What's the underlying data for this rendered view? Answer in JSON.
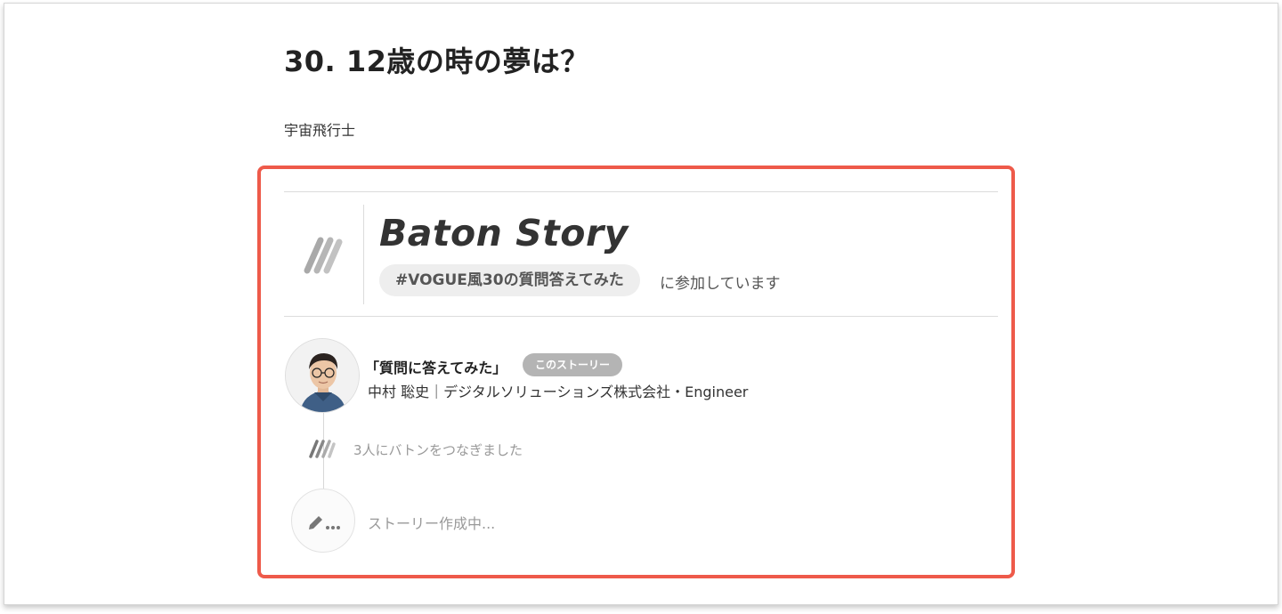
{
  "question": {
    "title": "30. 12歳の時の夢は？",
    "answer": "宇宙飛行士"
  },
  "baton": {
    "brand": "Baton Story",
    "hashtag": "#VOGUE風30の質問答えてみた",
    "joined_text": "に参加しています",
    "logo_icon": "baton-sticks-icon"
  },
  "story": {
    "title": "「質問に答えてみた」",
    "badge": "このストーリー",
    "author": "中村 聡史｜デジタルソリューションズ株式会社・Engineer",
    "passed_text": "3人にバトンをつなぎました",
    "draft_text": "ストーリー作成中..."
  },
  "colors": {
    "highlight_border": "#ee5a4a",
    "badge_bg": "#b4b4b4",
    "chip_bg": "#eeeeee",
    "muted_text": "#999999"
  }
}
